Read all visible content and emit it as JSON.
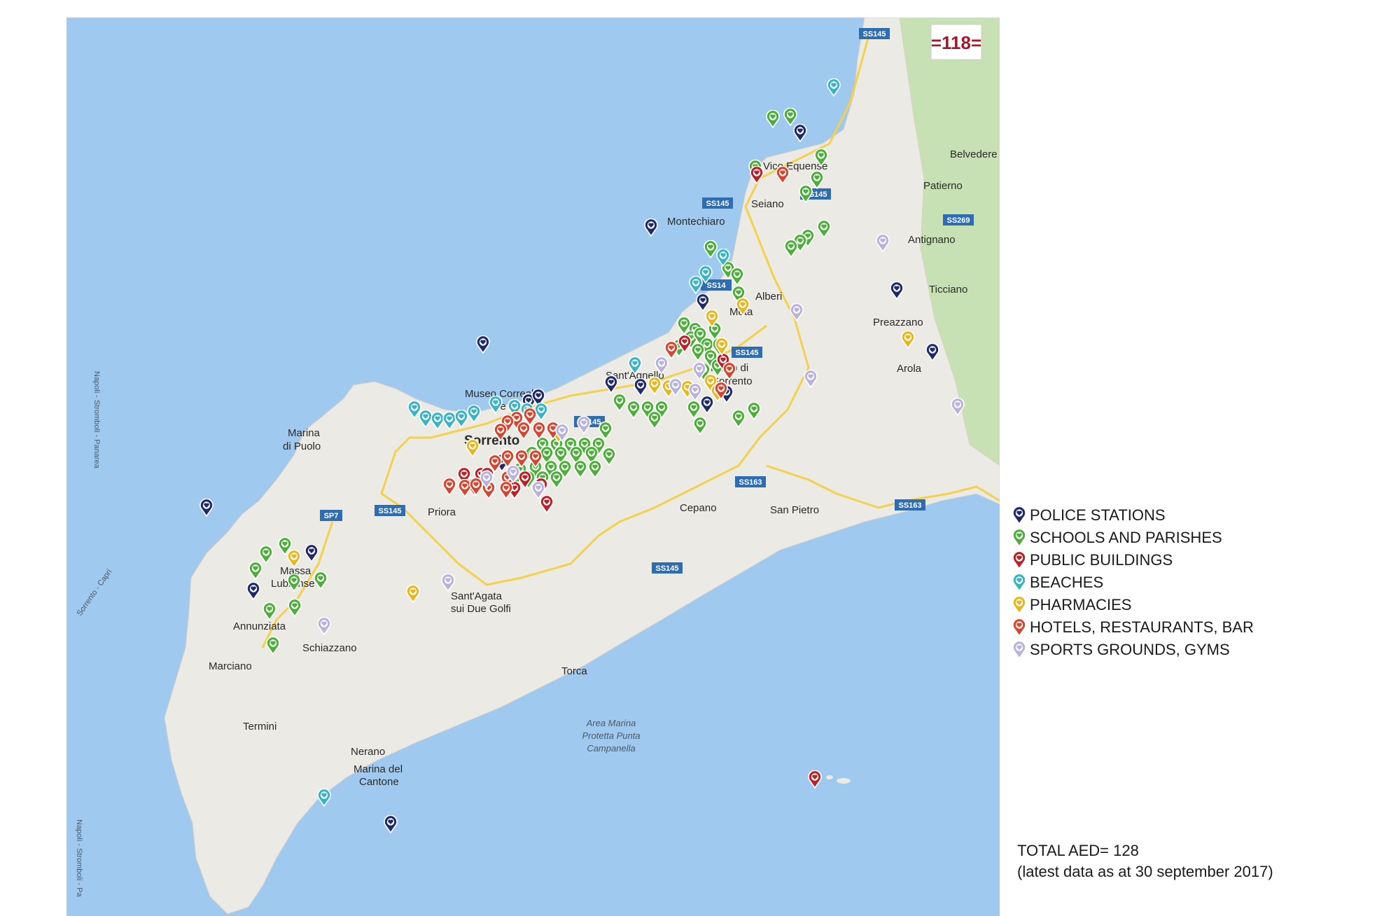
{
  "badge": "=118=",
  "places": [
    "Vico Equense",
    "Belvedere",
    "Patierno",
    "Seiano",
    "Montechiaro",
    "Antignano",
    "Alberi",
    "Meta",
    "Ticciano",
    "Preazzano",
    "Arola",
    "Sant'Agnello",
    "Piano di",
    "Sorrento",
    "Museo Correale",
    "Te",
    "Sorrento",
    "Marina",
    "di Puolo",
    "Priora",
    "Cepano",
    "San Pietro",
    "Massa",
    "Lubrense",
    "Sant'Agata",
    "sui Due Golfi",
    "Annunziata",
    "Schiazzano",
    "Marciano",
    "Torca",
    "Termini",
    "Nerano",
    "Marina del",
    "Cantone"
  ],
  "roads": [
    "SS145",
    "SS145",
    "SS145",
    "SS269",
    "SS14",
    "SS145",
    "SS145",
    "SS163",
    "SS163",
    "SP7",
    "SS145",
    "SS145"
  ],
  "marine_area": [
    "Area Marina",
    "Protetta Punta",
    "Campanella"
  ],
  "ferry_routes": [
    "Napoli - Stromboli - Panarea",
    "Sorrento - Capri",
    "Napoli - Stromboli - Pa"
  ],
  "legend": [
    {
      "label": "POLICE STATIONS",
      "color": "#1f2a6b",
      "icon": "police-marker-icon"
    },
    {
      "label": "SCHOOLS AND PARISHES",
      "color": "#4caf3a",
      "icon": "school-marker-icon"
    },
    {
      "label": "PUBLIC BUILDINGS",
      "color": "#b8232a",
      "icon": "public-building-marker-icon"
    },
    {
      "label": "BEACHES",
      "color": "#39b4c6",
      "icon": "beach-marker-icon"
    },
    {
      "label": "PHARMACIES",
      "color": "#e6b820",
      "icon": "pharmacy-marker-icon"
    },
    {
      "label": "HOTELS, RESTAURANTS, BAR",
      "color": "#d6452e",
      "icon": "hotel-marker-icon"
    },
    {
      "label": "SPORTS GROUNDS, GYMS",
      "color": "#b9b2dd",
      "icon": "sports-marker-icon"
    }
  ],
  "total": {
    "line1": "TOTAL AED= 128",
    "line2": "(latest data as at 30 september 2017)"
  }
}
